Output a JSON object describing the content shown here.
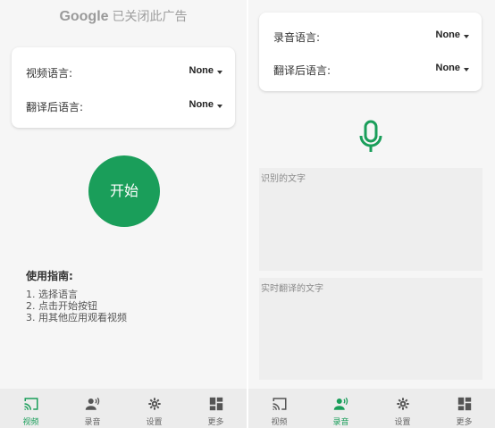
{
  "colors": {
    "accent": "#1a9e5a",
    "inactive": "#666666"
  },
  "left": {
    "ad_brand": "Google",
    "ad_text": "已关闭此广告",
    "settings": [
      {
        "label": "视频语言:",
        "value": "None"
      },
      {
        "label": "翻译后语言:",
        "value": "None"
      }
    ],
    "start_label": "开始",
    "guide_title": "使用指南:",
    "guide_steps": [
      "1. 选择语言",
      "2. 点击开始按钮",
      "3. 用其他应用观看视频"
    ],
    "nav": [
      {
        "label": "视频",
        "icon": "cast-icon",
        "active": true
      },
      {
        "label": "录音",
        "icon": "record-voice-icon",
        "active": false
      },
      {
        "label": "设置",
        "icon": "gear-icon",
        "active": false
      },
      {
        "label": "更多",
        "icon": "dashboard-icon",
        "active": false
      }
    ]
  },
  "right": {
    "settings": [
      {
        "label": "录音语言:",
        "value": "None"
      },
      {
        "label": "翻译后语言:",
        "value": "None"
      }
    ],
    "recognized_placeholder": "识别的文字",
    "translated_placeholder": "实时翻译的文字",
    "nav": [
      {
        "label": "视频",
        "icon": "cast-icon",
        "active": false
      },
      {
        "label": "录音",
        "icon": "record-voice-icon",
        "active": true
      },
      {
        "label": "设置",
        "icon": "gear-icon",
        "active": false
      },
      {
        "label": "更多",
        "icon": "dashboard-icon",
        "active": false
      }
    ]
  }
}
